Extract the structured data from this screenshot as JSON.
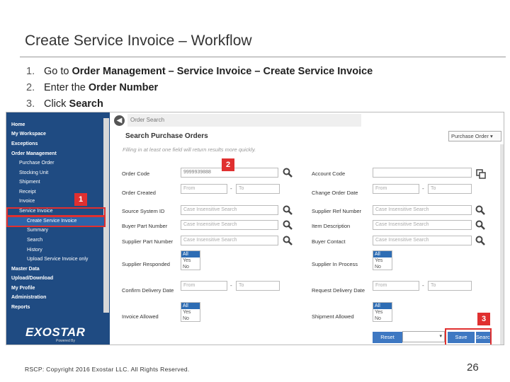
{
  "slide": {
    "title": "Create Service Invoice – Workflow",
    "steps": [
      {
        "num": "1.",
        "text": "Go to ",
        "bold": "Order Management – Service Invoice – Create Service Invoice"
      },
      {
        "num": "2.",
        "text": "Enter the ",
        "bold": "Order Number"
      },
      {
        "num": "3.",
        "text": "Click ",
        "bold": "Search"
      }
    ],
    "footer": "RSCP: Copyright 2016 Exostar LLC. All Rights Reserved.",
    "page_number": "26"
  },
  "nav": {
    "items": [
      {
        "label": "Home"
      },
      {
        "label": "My Workspace"
      },
      {
        "label": "Exceptions"
      },
      {
        "label": "Order Management"
      },
      {
        "label": "Purchase Order"
      },
      {
        "label": "Stocking Unit"
      },
      {
        "label": "Shipment"
      },
      {
        "label": "Receipt"
      },
      {
        "label": "Invoice"
      },
      {
        "label": "Service Invoice"
      },
      {
        "label": "Create Service Invoice"
      },
      {
        "label": "Summary"
      },
      {
        "label": "Search"
      },
      {
        "label": "History"
      },
      {
        "label": "Upload Service Invoice only"
      },
      {
        "label": "Master Data"
      },
      {
        "label": "Upload/Download"
      },
      {
        "label": "My Profile"
      },
      {
        "label": "Administration"
      },
      {
        "label": "Reports"
      }
    ],
    "logo": "EXOSTAR",
    "logo_sub": "Powered By"
  },
  "form": {
    "breadcrumb": "Order Search",
    "title": "Search Purchase Orders",
    "hint": "Filling in at least one field will return results more quickly.",
    "order_type": "Purchase Order",
    "fields": {
      "order_code": {
        "label": "Order Code",
        "value": "9999939888"
      },
      "order_created": {
        "label": "Order Created",
        "from": "From",
        "to": "To"
      },
      "source_system_id": {
        "label": "Source System ID",
        "placeholder": "Case Insensitive Search"
      },
      "buyer_part_number": {
        "label": "Buyer Part Number",
        "placeholder": "Case Insensitive Search"
      },
      "supplier_part_number": {
        "label": "Supplier Part Number",
        "placeholder": "Case Insensitive Search"
      },
      "supplier_responded": {
        "label": "Supplier Responded",
        "options": [
          "All",
          "Yes",
          "No"
        ]
      },
      "confirm_delivery_date": {
        "label": "Confirm Delivery Date",
        "from": "From",
        "to": "To"
      },
      "invoice_allowed": {
        "label": "Invoice Allowed",
        "options": [
          "All",
          "Yes",
          "No"
        ]
      },
      "account_code": {
        "label": "Account Code",
        "value": ""
      },
      "change_order_date": {
        "label": "Change Order Date",
        "from": "From",
        "to": "To"
      },
      "supplier_ref_number": {
        "label": "Supplier Ref Number",
        "placeholder": "Case Insensitive Search"
      },
      "item_description": {
        "label": "Item Description",
        "placeholder": "Case Insensitive Search"
      },
      "buyer_contact": {
        "label": "Buyer Contact",
        "placeholder": "Case Insensitive Search"
      },
      "supplier_in_process": {
        "label": "Supplier In Process",
        "options": [
          "All",
          "Yes",
          "No"
        ]
      },
      "request_delivery_date": {
        "label": "Request Delivery Date",
        "from": "From",
        "to": "To"
      },
      "shipment_allowed": {
        "label": "Shipment Allowed",
        "options": [
          "All",
          "Yes",
          "No"
        ]
      }
    },
    "buttons": {
      "reset": "Reset",
      "save": "Save",
      "search": "Search"
    }
  },
  "badges": {
    "b1": "1",
    "b2": "2",
    "b3": "3"
  },
  "colors": {
    "nav_bg": "#1f4b82",
    "highlight": "#e03030",
    "button": "#3e78c2"
  }
}
